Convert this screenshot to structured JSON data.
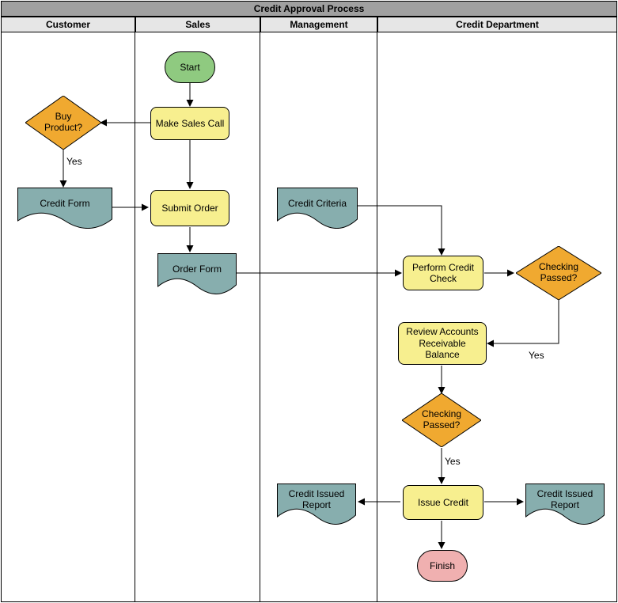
{
  "title": "Credit Approval Process",
  "lanes": {
    "customer": "Customer",
    "sales": "Sales",
    "management": "Management",
    "credit_dept": "Credit Department"
  },
  "nodes": {
    "start": "Start",
    "make_sales_call": "Make Sales Call",
    "buy_product": "Buy Product?",
    "credit_form": "Credit Form",
    "submit_order": "Submit Order",
    "order_form": "Order Form",
    "credit_criteria": "Credit Criteria",
    "perform_credit_check": "Perform Credit Check",
    "checking_passed_1": "Checking Passed?",
    "review_ar_balance": "Review Accounts Receivable Balance",
    "checking_passed_2": "Checking Passed?",
    "issue_credit": "Issue Credit",
    "credit_issued_report_left": "Credit Issued Report",
    "credit_issued_report_right": "Credit Issued Report",
    "finish": "Finish"
  },
  "edge_labels": {
    "buy_product_yes": "Yes",
    "checking_passed_1_yes": "Yes",
    "checking_passed_2_yes": "Yes"
  }
}
